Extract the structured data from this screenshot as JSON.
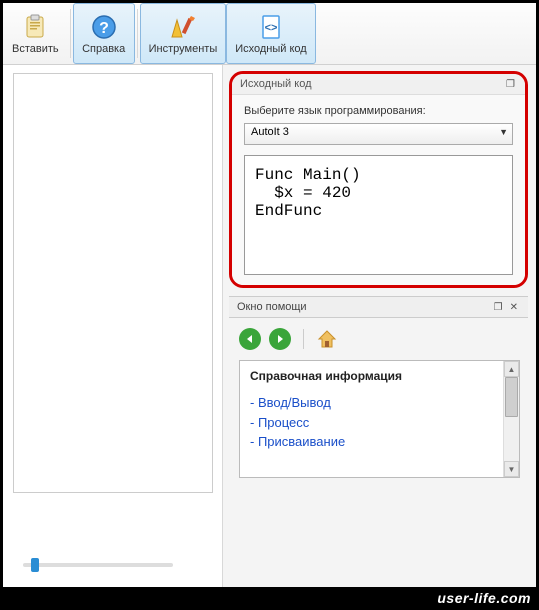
{
  "toolbar": {
    "paste": "Вставить",
    "help": "Справка",
    "tools": "Инструменты",
    "source": "Исходный код"
  },
  "source_panel": {
    "title": "Исходный код",
    "instruction": "Выберите язык программирования:",
    "language": "AutoIt 3",
    "code": "Func Main()\n  $x = 420\nEndFunc"
  },
  "help_panel": {
    "title": "Окно помощи",
    "info_heading": "Справочная информация",
    "links": {
      "l0": "- Ввод/Вывод",
      "l1": "- Процесс",
      "l2": "- Присваивание"
    }
  },
  "watermark": "user-life.com"
}
